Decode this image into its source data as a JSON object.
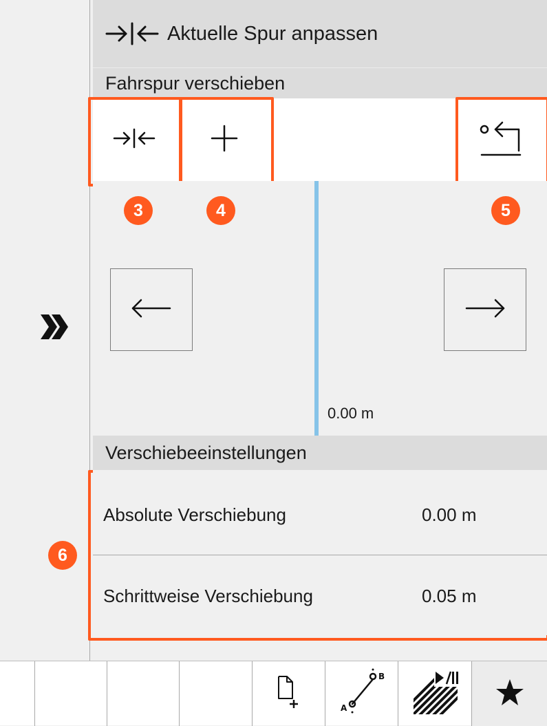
{
  "header": {
    "title": "Aktuelle Spur anpassen"
  },
  "lane_shift": {
    "section_label": "Fahrspur verschieben",
    "offset_display": "0.00 m"
  },
  "shift_settings": {
    "section_label": "Verschiebeeinstellungen",
    "rows": [
      {
        "label": "Absolute Verschiebung",
        "value": "0.00 m"
      },
      {
        "label": "Schrittweise Verschiebung",
        "value": "0.05 m"
      }
    ]
  },
  "annotations": {
    "badges": [
      "3",
      "4",
      "5",
      "6"
    ],
    "color": "#ff5a1f"
  },
  "icons": {
    "title": "center-lane-icon",
    "toolbar": [
      "center-lane-icon",
      "plus-icon",
      "reset-return-icon"
    ],
    "arrows": [
      "arrow-left-icon",
      "arrow-right-icon"
    ],
    "rail": "double-chevron-right-icon",
    "bottom_bar": [
      "new-field-icon",
      "ab-line-icon",
      "section-control-play-pause-icon",
      "star-icon"
    ]
  },
  "colors": {
    "lane_line": "#86c3e8",
    "header_bg": "#dcdcdc"
  }
}
